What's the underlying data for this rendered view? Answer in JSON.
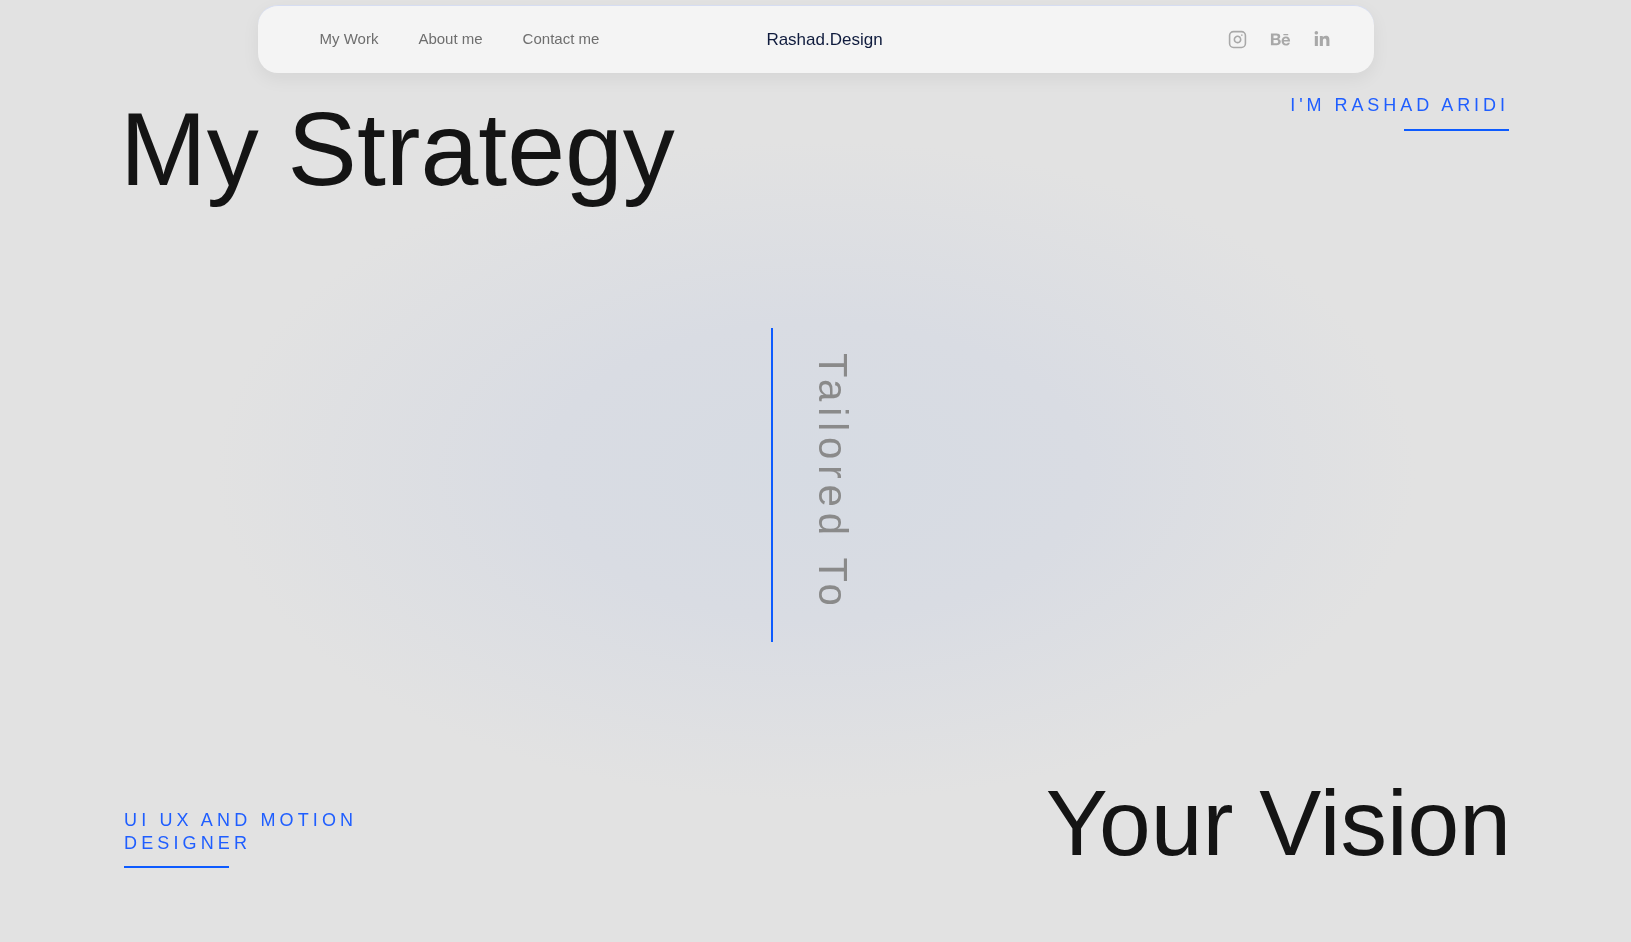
{
  "nav": {
    "links": [
      {
        "label": "My Work"
      },
      {
        "label": "About me"
      },
      {
        "label": "Contact me"
      }
    ],
    "logo": "Rashad.Design"
  },
  "hero": {
    "title": "My Strategy",
    "tagline": "I'M RASHAD ARIDI",
    "vertical_text": "Tailored To",
    "role": "UI UX AND MOTION DESIGNER",
    "subtitle": "Your Vision"
  }
}
